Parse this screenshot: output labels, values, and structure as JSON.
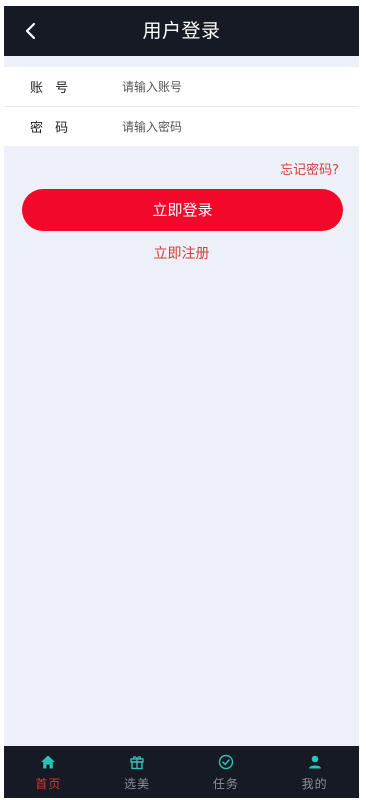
{
  "header": {
    "title": "用户登录",
    "back_icon": "chevron-left-icon"
  },
  "form": {
    "account": {
      "label": "账 号",
      "placeholder": "请输入账号",
      "value": ""
    },
    "password": {
      "label": "密 码",
      "placeholder": "请输入密码",
      "value": ""
    }
  },
  "links": {
    "forgot": "忘记密码?",
    "register": "立即注册"
  },
  "login_button": "立即登录",
  "tabbar": {
    "items": [
      {
        "label": "首页",
        "icon": "home-icon",
        "active": true
      },
      {
        "label": "选美",
        "icon": "gift-icon",
        "active": false
      },
      {
        "label": "任务",
        "icon": "task-icon",
        "active": false
      },
      {
        "label": "我的",
        "icon": "user-icon",
        "active": false
      }
    ]
  },
  "colors": {
    "header_bg": "#161a24",
    "page_bg": "#eef0f7",
    "primary_button": "#f2082b",
    "link_red": "#d83a3a",
    "tab_icon_teal": "#2bc4b4",
    "tab_active_text": "#e63232"
  }
}
